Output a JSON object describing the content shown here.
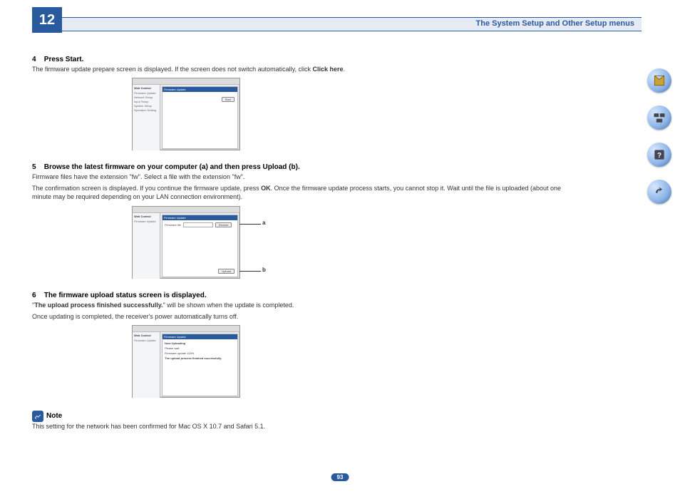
{
  "chapter_number": "12",
  "header_title": "The System Setup and Other Setup menus",
  "page_number": "93",
  "sidebar_buttons": [
    "toc-icon",
    "components-icon",
    "help-icon",
    "connect-icon"
  ],
  "step4": {
    "num": "4",
    "title": "Press Start.",
    "body_before": "The firmware update prepare screen is displayed. If the screen does not switch automatically, click ",
    "body_bold": "Click here",
    "body_after": "."
  },
  "step5": {
    "num": "5",
    "title": "Browse the latest firmware on your computer (a) and then press Upload (b).",
    "line1_before": "Firmware files have the extension \"fw\". Select a file with the extension \"fw\".",
    "line2_before": "The confirmation screen is displayed. If you continue the firmware update, press ",
    "line2_bold": "OK",
    "line2_after": ". Once the firmware update process starts, you cannot stop it. Wait until the file is uploaded (about one minute may be required depending on your LAN connection environment)."
  },
  "step6": {
    "num": "6",
    "title": "The firmware upload status screen is displayed.",
    "quote_bold": "The upload process finished successfully.",
    "quote_after": "\" will be shown when the update is completed.",
    "line2": "Once updating is completed, the receiver's power automatically turns off."
  },
  "note": {
    "label": "Note",
    "body": "This setting for the network has been confirmed for Mac OS X 10.7 and Safari 5.1."
  },
  "fig_common": {
    "sidebar_title": "Web Control",
    "panel_title": "Firmware Update"
  },
  "fig1": {
    "items": [
      "Firmware Update",
      "Network Setup",
      "Input Setup",
      "System Setup",
      "Operation Setting"
    ],
    "button": "Start"
  },
  "fig2": {
    "items": [
      "Firmware Update"
    ],
    "row_label": "Firmware file",
    "browse": "Browse",
    "upload": "Upload",
    "annot_a": "a",
    "annot_b": "b"
  },
  "fig3": {
    "items": [
      "Firmware Update"
    ],
    "lines": [
      "Now Uploading",
      "Please wait",
      "",
      "Firmware update 100%",
      "",
      "The upload process finished successfully."
    ]
  }
}
